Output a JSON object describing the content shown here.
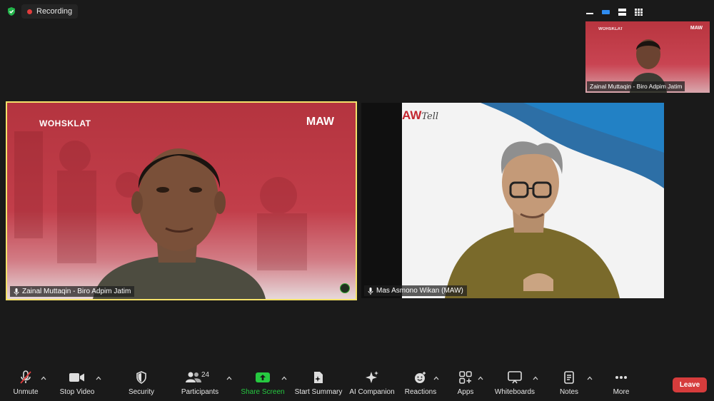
{
  "recording": {
    "label": "Recording"
  },
  "thumbnail": {
    "name": "Zainal Muttaqin - Biro Adpim Jatim",
    "brand": "MAW",
    "brand_left": "WOHSKLAT"
  },
  "tile_a": {
    "name": "Zainal Muttaqin - Biro Adpim Jatim",
    "talkshow": "WOHSKLAT",
    "logo": "MAW"
  },
  "tile_b": {
    "name": "Mas Asmono Wikan (MAW)",
    "logo": "AW",
    "logo_script": "Tell"
  },
  "toolbar": {
    "unmute": "Unmute",
    "stop_video": "Stop Video",
    "security": "Security",
    "participants": "Participants",
    "participants_count": "24",
    "share_screen": "Share Screen",
    "start_summary": "Start Summary",
    "ai_companion": "AI Companion",
    "reactions": "Reactions",
    "apps": "Apps",
    "whiteboards": "Whiteboards",
    "notes": "Notes",
    "more": "More",
    "leave": "Leave"
  },
  "colors": {
    "active_speaker_border": "#f4e16a",
    "leave": "#d63c3c",
    "share": "#26c940",
    "recording_dot": "#e23c3c"
  }
}
